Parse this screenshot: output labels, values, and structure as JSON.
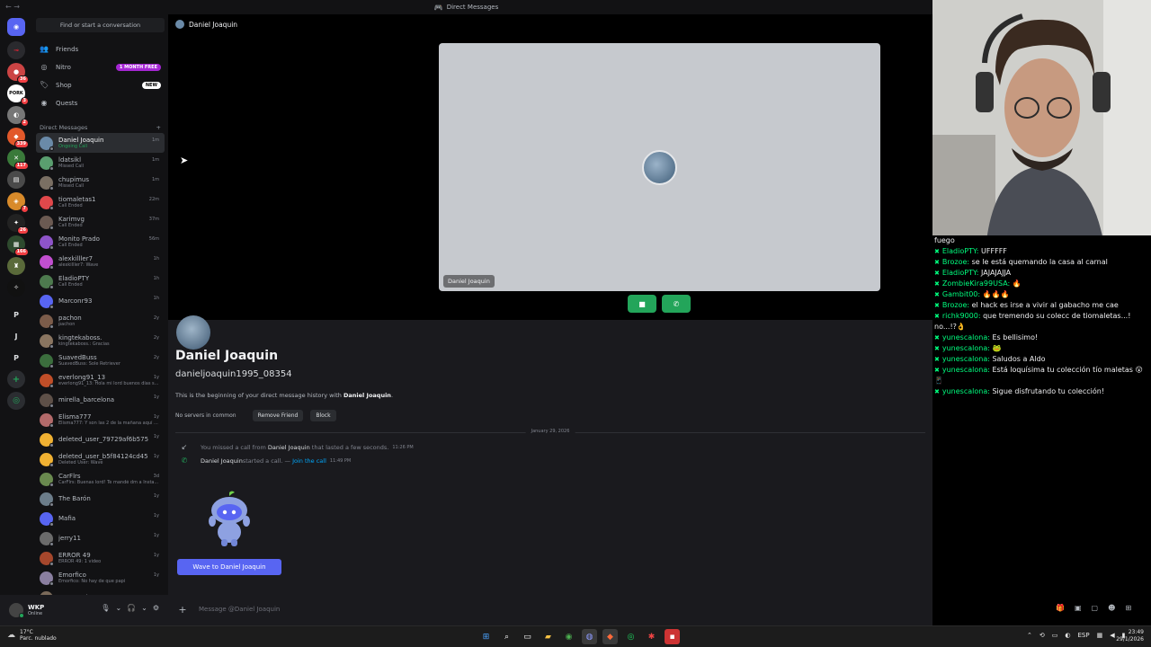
{
  "window": {
    "title": "Direct Messages"
  },
  "search": {
    "placeholder": "Find or start a conversation"
  },
  "nav": [
    {
      "label": "Friends",
      "icon": "friends-icon"
    },
    {
      "label": "Nitro",
      "icon": "nitro-icon",
      "badge": "1 MONTH FREE"
    },
    {
      "label": "Shop",
      "icon": "shop-icon",
      "badge": "NEW"
    },
    {
      "label": "Quests",
      "icon": "quests-icon"
    }
  ],
  "dm_header": {
    "label": "Direct Messages",
    "add": "+"
  },
  "dms": [
    {
      "name": "Daniel Joaquin",
      "sub": "Ongoing Call",
      "time": "1m",
      "color": "#6a8aa8"
    },
    {
      "name": "ldatsikl",
      "sub": "Missed Call",
      "time": "1m",
      "color": "#5a9e6f"
    },
    {
      "name": "chupimus",
      "sub": "Missed Call",
      "time": "1m",
      "color": "#7a6f63"
    },
    {
      "name": "tiomaletas1",
      "sub": "Call Ended",
      "time": "22m",
      "color": "#e0484b"
    },
    {
      "name": "Karimvg",
      "sub": "Call Ended",
      "time": "37m",
      "color": "#6b5a52"
    },
    {
      "name": "Monito Prado",
      "sub": "Call Ended",
      "time": "56m",
      "color": "#8e54c9"
    },
    {
      "name": "alexkilller7",
      "sub": "alexkilller7: Wave",
      "time": "1h",
      "color": "#c24fd0"
    },
    {
      "name": "EladioPTY",
      "sub": "Call Ended",
      "time": "1h",
      "color": "#4d7a4e"
    },
    {
      "name": "Marconr93",
      "sub": "",
      "time": "1h",
      "color": "#5865f2"
    },
    {
      "name": "pachon",
      "sub": "pachon",
      "time": "2y",
      "color": "#7c5c4a"
    },
    {
      "name": "kingtekaboss.",
      "sub": "kingtekaboss.: Gracias",
      "time": "2y",
      "color": "#8a7560"
    },
    {
      "name": "SuavedBuss",
      "sub": "SuavedBuss: Sole Retriever",
      "time": "2y",
      "color": "#3b6e3d"
    },
    {
      "name": "everlong91_13",
      "sub": "everlong91_13: Hola mi lord buenos días s...",
      "time": "1y",
      "color": "#c04e28"
    },
    {
      "name": "mirella_barcelona",
      "sub": "",
      "time": "1y",
      "color": "#5e5048"
    },
    {
      "name": "Elisma777",
      "sub": "Elisma777: Y son las 2 de la mañana aquí ...",
      "time": "1y",
      "color": "#b36a6a"
    },
    {
      "name": "deleted_user_79729af6b575",
      "sub": "",
      "time": "1y",
      "color": "#f0b132"
    },
    {
      "name": "deleted_user_b5f84124cd45",
      "sub": "Deleted User: Wave",
      "time": "1y",
      "color": "#f0b132"
    },
    {
      "name": "CarFlrs",
      "sub": "CarFlrs: Buenas lord! Te mandé dm a Insta...",
      "time": "3d",
      "color": "#6a8a4f"
    },
    {
      "name": "The Barón",
      "sub": "",
      "time": "1y",
      "color": "#6c7d8a"
    },
    {
      "name": "Mafia",
      "sub": "",
      "time": "1y",
      "color": "#5865f2"
    },
    {
      "name": "jerry11",
      "sub": "",
      "time": "1y",
      "color": "#6b6b6b"
    },
    {
      "name": "ERROR 49",
      "sub": "ERROR 49: 1 video",
      "time": "1y",
      "color": "#a5472c"
    },
    {
      "name": "Emorfico",
      "sub": "Emorfico: No hay de que papi",
      "time": "1y",
      "color": "#8a7fa0"
    },
    {
      "name": "Yue Escalona",
      "sub": "",
      "time": "",
      "color": "#7a6a5a"
    }
  ],
  "user": {
    "name": "WKP",
    "status": "Online"
  },
  "channel": {
    "name": "Daniel Joaquin"
  },
  "call": {
    "tile_label": "Daniel Joaquin"
  },
  "profile": {
    "name": "Daniel Joaquin",
    "username": "danieljoaquin1995_08354",
    "desc_prefix": "This is the beginning of your direct message history with ",
    "desc_name": "Daniel Joaquin",
    "desc_suffix": ".",
    "no_servers": "No servers in common",
    "remove_friend": "Remove Friend",
    "block": "Block"
  },
  "date_divider": "January 29, 2026",
  "messages": {
    "missed_1": "You missed a call from ",
    "missed_name": "Daniel Joaquin",
    "missed_2": " that lasted a few seconds.",
    "missed_time": "11:26 PM",
    "started_name": "Daniel Joaquin",
    "started_text": " started a call. — ",
    "join": "Join the call",
    "started_time": "11:49 PM"
  },
  "wave_button": "Wave to Daniel Joaquin",
  "composer": {
    "placeholder": "Message @Daniel Joaquin"
  },
  "chat": [
    {
      "user": "",
      "text": "fuego"
    },
    {
      "user": "EladioPTY:",
      "text": " UFFFFF"
    },
    {
      "user": "Brozoe:",
      "text": " se le está quemando la casa al carnal"
    },
    {
      "user": "EladioPTY:",
      "text": " JAJAJAJJA"
    },
    {
      "user": "ZombieKira99USA:",
      "text": " 🔥"
    },
    {
      "user": "Gambit00:",
      "text": " 🔥🔥🔥"
    },
    {
      "user": "Brozoe:",
      "text": " el hack es irse a vivir al gabacho me cae"
    },
    {
      "user": "richk9000:",
      "text": " que tremendo su colecc de tiomaletas...! no...!?👌"
    },
    {
      "user": "yunescalona:",
      "text": " Es bellisimo!"
    },
    {
      "user": "yunescalona:",
      "text": " 🐸"
    },
    {
      "user": "yunescalona:",
      "text": " Saludos a Aldo"
    },
    {
      "user": "yunescalona:",
      "text": " Está loquísima tu colección tío maletas 😮📱"
    },
    {
      "user": "yunescalona:",
      "text": " Sigue disfrutando tu colección!"
    }
  ],
  "taskbar": {
    "weather_temp": "17°C",
    "weather_desc": "Parc. nublado",
    "lang": "ESP",
    "time": "23:49",
    "date": "29/1/2026"
  },
  "colors": {
    "accent": "#5865f2",
    "green": "#23a55a",
    "chat_user": "#00ff7f"
  }
}
